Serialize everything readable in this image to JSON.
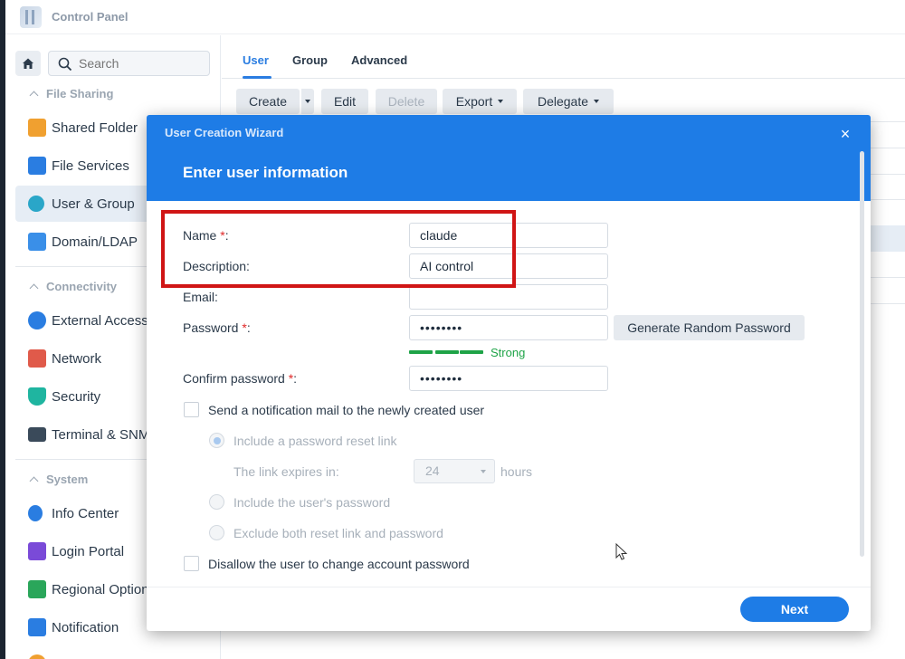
{
  "app": {
    "title": "Control Panel",
    "icon": "control-panel-icon"
  },
  "sidebar": {
    "search_placeholder": "Search",
    "sections": [
      {
        "title": "File Sharing",
        "items": [
          {
            "label": "Shared Folder",
            "icon": "shared-folder-icon",
            "color": "#f0a030"
          },
          {
            "label": "File Services",
            "icon": "file-services-icon",
            "color": "#2a7de1"
          },
          {
            "label": "User & Group",
            "icon": "user-group-icon",
            "color": "#2aa6c8",
            "active": true
          },
          {
            "label": "Domain/LDAP",
            "icon": "domain-ldap-icon",
            "color": "#3a8fe8"
          }
        ]
      },
      {
        "title": "Connectivity",
        "items": [
          {
            "label": "External Access",
            "icon": "external-access-icon",
            "color": "#2a7de1"
          },
          {
            "label": "Network",
            "icon": "network-icon",
            "color": "#e05a4a"
          },
          {
            "label": "Security",
            "icon": "security-shield-icon",
            "color": "#1fb5a0"
          },
          {
            "label": "Terminal & SNMP",
            "icon": "terminal-icon",
            "color": "#3a4a5a"
          }
        ]
      },
      {
        "title": "System",
        "items": [
          {
            "label": "Info Center",
            "icon": "info-icon",
            "color": "#2a7de1"
          },
          {
            "label": "Login Portal",
            "icon": "login-portal-icon",
            "color": "#7a4ad8"
          },
          {
            "label": "Regional Options",
            "icon": "regional-options-icon",
            "color": "#2aa65a"
          },
          {
            "label": "Notification",
            "icon": "notification-icon",
            "color": "#2a7de1"
          }
        ]
      }
    ]
  },
  "tabs": [
    {
      "label": "User",
      "active": true
    },
    {
      "label": "Group"
    },
    {
      "label": "Advanced"
    }
  ],
  "toolbar": {
    "create": "Create",
    "edit": "Edit",
    "delete": "Delete",
    "export": "Export",
    "delegate": "Delegate"
  },
  "wizard": {
    "title": "User Creation Wizard",
    "heading": "Enter user information",
    "fields": {
      "name": {
        "label": "Name",
        "required": "*",
        "suffix": ":",
        "value": "claude"
      },
      "description": {
        "label": "Description:",
        "value": "AI control"
      },
      "email": {
        "label": "Email:",
        "value": ""
      },
      "password": {
        "label": "Password",
        "required": "*",
        "suffix": ":",
        "value": "••••••••"
      },
      "confirm": {
        "label": "Confirm password",
        "required": "*",
        "suffix": ":",
        "value": "••••••••"
      }
    },
    "generate_password": "Generate Random Password",
    "strength": "Strength",
    "strength_label": "Strong",
    "strength_color": "#1ea347",
    "send_notification": "Send a notification mail to the newly created user",
    "include_reset_link": "Include a password reset link",
    "link_expires": "The link expires in:",
    "expires_value": "24",
    "hours": "hours",
    "include_password": "Include the user's password",
    "exclude_both": "Exclude both reset link and password",
    "disallow_change": "Disallow the user to change account password",
    "next": "Next",
    "close": "×"
  },
  "colors": {
    "accent": "#1e7ce6",
    "highlight": "#d01515"
  }
}
